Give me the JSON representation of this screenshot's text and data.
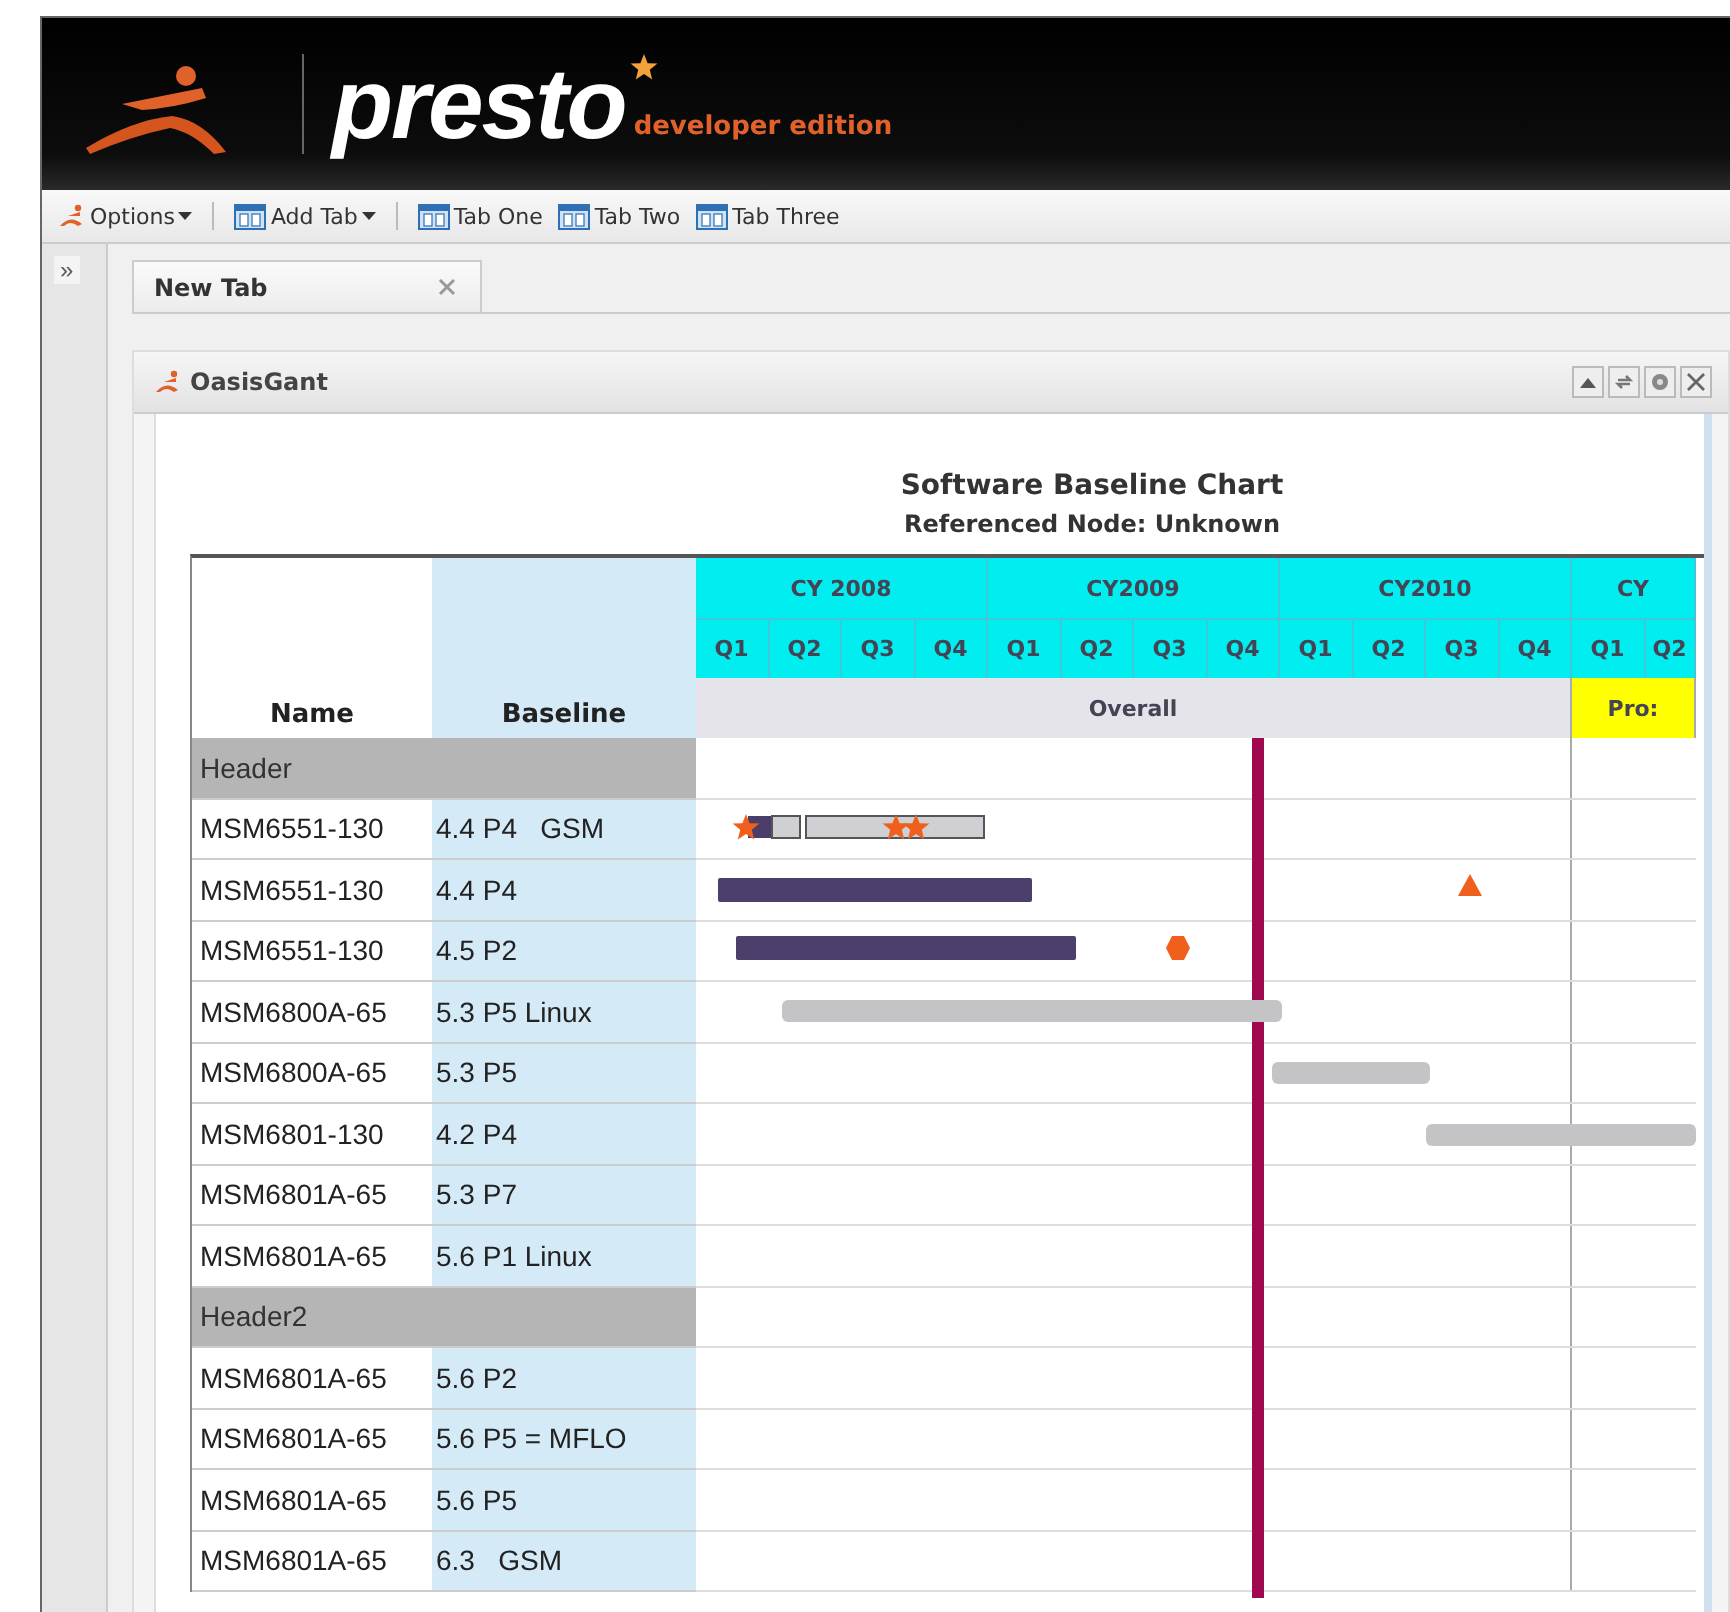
{
  "header": {
    "logo": "presto",
    "edition": "developer edition"
  },
  "toolbar": [
    {
      "label": "Options",
      "kind": "menu"
    },
    {
      "label": "Add Tab",
      "kind": "menu"
    },
    {
      "label": "Tab One",
      "kind": "tab"
    },
    {
      "label": "Tab Two",
      "kind": "tab"
    },
    {
      "label": "Tab Three",
      "kind": "tab"
    }
  ],
  "sidebar": {
    "toggle": "»"
  },
  "tabs": [
    {
      "label": "New Tab",
      "selected": true
    }
  ],
  "portlet": {
    "title": "OasisGant"
  },
  "chart": {
    "title": "Software Baseline Chart",
    "subtitle": "Referenced Node: Unknown",
    "columns": [
      "Name",
      "Baseline"
    ],
    "years": [
      "CY 2008",
      "CY2009",
      "CY2010",
      "CY"
    ],
    "quarters": [
      "Q1",
      "Q2",
      "Q3",
      "Q4",
      "Q1",
      "Q2",
      "Q3",
      "Q4",
      "Q1",
      "Q2",
      "Q3",
      "Q4",
      "Q1",
      "Q2"
    ],
    "phases": [
      {
        "label": "Overall",
        "color": "#e4e4ea"
      },
      {
        "label": "Pro:",
        "color": "#ffff00"
      }
    ],
    "rows": [
      {
        "kind": "group",
        "name": "Header"
      },
      {
        "kind": "item",
        "name": "MSM6551-130",
        "baseline": "4.4 P4   GSM"
      },
      {
        "kind": "item",
        "name": "MSM6551-130",
        "baseline": "4.4 P4"
      },
      {
        "kind": "item",
        "name": "MSM6551-130",
        "baseline": "4.5 P2"
      },
      {
        "kind": "item",
        "name": "MSM6800A-65",
        "baseline": "5.3 P5 Linux"
      },
      {
        "kind": "item",
        "name": "MSM6800A-65",
        "baseline": "5.3 P5"
      },
      {
        "kind": "item",
        "name": "MSM6801-130",
        "baseline": "4.2 P4"
      },
      {
        "kind": "item",
        "name": "MSM6801A-65",
        "baseline": "5.3 P7"
      },
      {
        "kind": "item",
        "name": "MSM6801A-65",
        "baseline": "5.6 P1 Linux"
      },
      {
        "kind": "group",
        "name": "Header2"
      },
      {
        "kind": "item",
        "name": "MSM6801A-65",
        "baseline": "5.6 P2"
      },
      {
        "kind": "item",
        "name": "MSM6801A-65",
        "baseline": "5.6 P5 = MFLO"
      },
      {
        "kind": "item",
        "name": "MSM6801A-65",
        "baseline": "5.6 P5"
      },
      {
        "kind": "item",
        "name": "MSM6801A-65",
        "baseline": "6.3   GSM"
      }
    ]
  }
}
